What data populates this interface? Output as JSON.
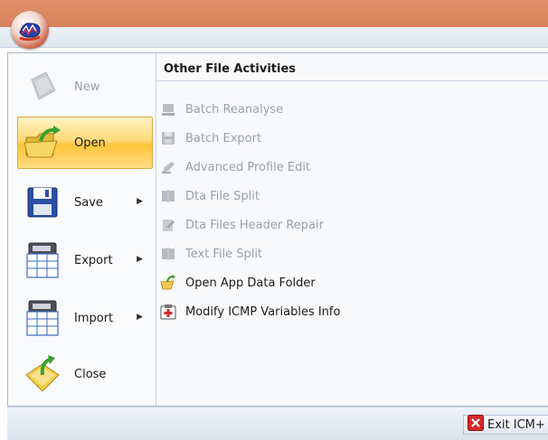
{
  "app": {
    "logo_icon": "app-orb-logo-icon"
  },
  "left_menu": {
    "items": [
      {
        "label": "New",
        "icon": "new-document-icon",
        "enabled": false,
        "submenu": false
      },
      {
        "label": "Open",
        "icon": "open-folder-icon",
        "enabled": true,
        "submenu": false,
        "selected": true
      },
      {
        "label": "Save",
        "icon": "floppy-disk-icon",
        "enabled": true,
        "submenu": true
      },
      {
        "label": "Export",
        "icon": "export-icon",
        "enabled": true,
        "submenu": true
      },
      {
        "label": "Import",
        "icon": "import-icon",
        "enabled": true,
        "submenu": true
      },
      {
        "label": "Close",
        "icon": "close-folder-icon",
        "enabled": true,
        "submenu": false
      }
    ]
  },
  "right_panel": {
    "heading": "Other File Activities",
    "items": [
      {
        "label": "Batch Reanalyse",
        "icon": "batch-reanalyse-icon",
        "enabled": false
      },
      {
        "label": "Batch Export",
        "icon": "batch-export-icon",
        "enabled": false
      },
      {
        "label": "Advanced Profile Edit",
        "icon": "profile-edit-icon",
        "enabled": false
      },
      {
        "label": "Dta File Split",
        "icon": "file-split-icon",
        "enabled": false
      },
      {
        "label": "Dta Files Header Repair",
        "icon": "header-repair-icon",
        "enabled": false
      },
      {
        "label": "Text File Split",
        "icon": "text-split-icon",
        "enabled": false
      },
      {
        "label": "Open App Data Folder",
        "icon": "folder-open-icon",
        "enabled": true
      },
      {
        "label": "Modify ICMP Variables Info",
        "icon": "variables-info-icon",
        "enabled": true
      }
    ]
  },
  "footer": {
    "exit_label": "Exit ICM+",
    "exit_icon": "exit-x-icon"
  },
  "colors": {
    "accent": "#ffc53a",
    "titlebar": "#d9825c",
    "disabled_text": "#9aa0a8",
    "exit_red": "#d42a2a"
  }
}
